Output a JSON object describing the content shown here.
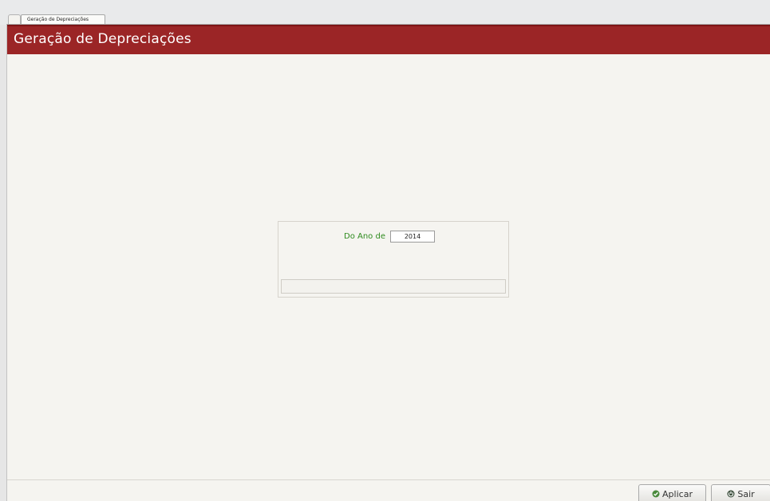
{
  "tab": {
    "label": "Geração de Depreciações"
  },
  "window": {
    "title": "Geração de Depreciações"
  },
  "form": {
    "year_label": "Do Ano de",
    "year_value": "2014"
  },
  "buttons": {
    "apply_label": "Aplicar",
    "apply_icon": "check-circle-icon",
    "exit_label": "Sair",
    "exit_icon": "power-icon"
  },
  "colors": {
    "title_bar": "#9b2526",
    "label_green": "#2e8b1e"
  }
}
